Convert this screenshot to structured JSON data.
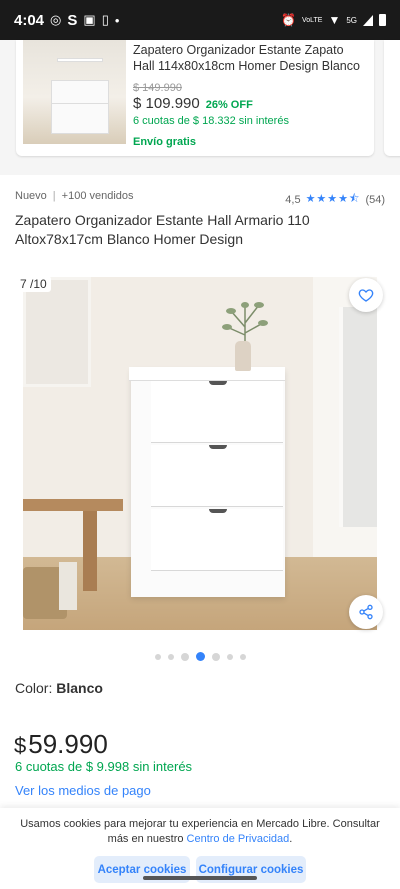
{
  "status_bar": {
    "time": "4:04",
    "network": "5G",
    "volte": "VoLTE",
    "left_icons": [
      "whatsapp-icon",
      "s-app-icon",
      "instagram-icon",
      "battery-saver-icon",
      "dot-icon"
    ],
    "right_icons": [
      "alarm-icon",
      "wifi-icon",
      "signal-icon",
      "battery-icon"
    ]
  },
  "related_product": {
    "title": "Zapatero Organizador Estante Zapato Hall 114x80x18cm Homer Design Blanco",
    "old_price": "$ 149.990",
    "price": "$ 109.990",
    "discount": "26% OFF",
    "installments": "6 cuotas de $ 18.332 sin interés",
    "shipping": "Envío gratis"
  },
  "product": {
    "condition": "Nuevo",
    "separator": "|",
    "sold": "+100 vendidos",
    "rating_value": "4,5",
    "stars": "★★★★⯪",
    "review_count": "(54)",
    "title": "Zapatero Organizador Estante Hall Armario 110 Altox78x17cm Blanco Homer Design"
  },
  "gallery": {
    "counter": "7 /10",
    "total_images": 10,
    "current_index": 7,
    "dots": [
      "small",
      "small",
      "big",
      "active",
      "big",
      "small",
      "small"
    ]
  },
  "variant": {
    "label": "Color: ",
    "value": "Blanco"
  },
  "pricing": {
    "currency": "$",
    "amount": "59.990",
    "installments": "6 cuotas de $ 9.998 sin interés",
    "payment_link": "Ver los medios de pago"
  },
  "cookie_banner": {
    "text": "Usamos cookies para mejorar tu experiencia en Mercado Libre. Consultar más en nuestro ",
    "link": "Centro de Privacidad",
    "text_end": ".",
    "accept_label": "Aceptar cookies",
    "config_label": "Configurar cookies"
  },
  "colors": {
    "accent_blue": "#3483fa",
    "green": "#00a650",
    "star_blue": "#3483fa"
  }
}
